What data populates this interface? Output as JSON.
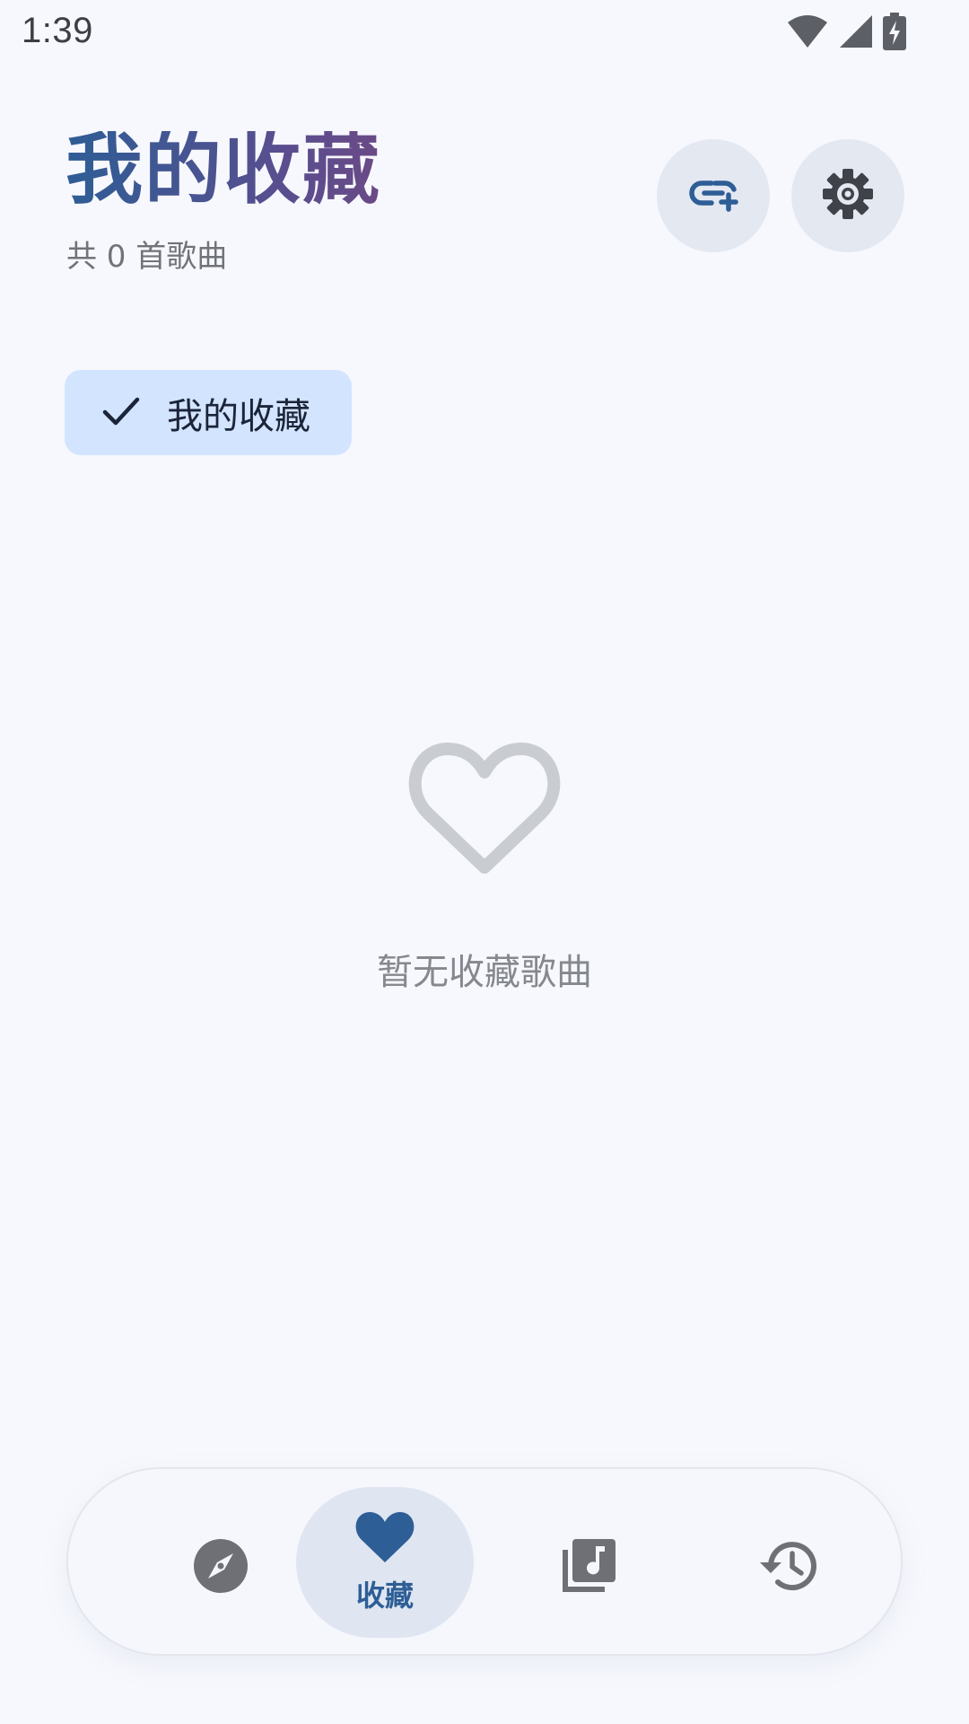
{
  "status_bar": {
    "time": "1:39",
    "icons": [
      "wifi-icon",
      "cellular-signal-icon",
      "battery-charging-icon"
    ]
  },
  "header": {
    "title": "我的收藏",
    "subtitle": "共 0 首歌曲",
    "actions": [
      {
        "name": "add-link",
        "icon": "link-add-icon"
      },
      {
        "name": "settings",
        "icon": "gear-icon"
      }
    ]
  },
  "chips": [
    {
      "label": "我的收藏",
      "selected": true,
      "icon": "check-icon"
    }
  ],
  "empty_state": {
    "icon": "heart-outline-icon",
    "text": "暂无收藏歌曲"
  },
  "bottom_nav": {
    "items": [
      {
        "icon": "compass-icon",
        "label": "",
        "selected": false
      },
      {
        "icon": "heart-icon",
        "label": "收藏",
        "selected": true
      },
      {
        "icon": "music-library-icon",
        "label": "",
        "selected": false
      },
      {
        "icon": "history-icon",
        "label": "",
        "selected": false
      }
    ]
  },
  "colors": {
    "background": "#f7f8fd",
    "accent": "#2e5e96",
    "chip_bg": "#d3e4ff",
    "title_gradient": [
      "#2e5d95",
      "#6a4a86"
    ],
    "icon_gray": "#6e7076"
  }
}
